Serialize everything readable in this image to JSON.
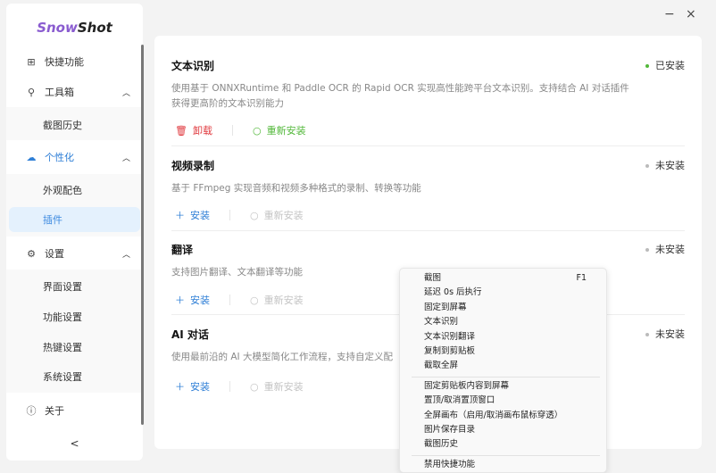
{
  "app": {
    "logo_part1": "Snow",
    "logo_part2": "Shot",
    "minimize": "−",
    "close": "×",
    "collapse": "<"
  },
  "sidebar": {
    "items": [
      {
        "label": "快捷功能",
        "icon": "grid-icon"
      },
      {
        "label": "工具箱",
        "icon": "wrench-icon"
      },
      {
        "label": "截图历史"
      },
      {
        "label": "个性化",
        "icon": "palette-icon"
      },
      {
        "label": "外观配色"
      },
      {
        "label": "插件"
      },
      {
        "label": "设置",
        "icon": "gear-icon"
      },
      {
        "label": "界面设置"
      },
      {
        "label": "功能设置"
      },
      {
        "label": "热键设置"
      },
      {
        "label": "系统设置"
      },
      {
        "label": "关于",
        "icon": "info-icon"
      }
    ]
  },
  "plugins": [
    {
      "title": "文本识别",
      "status": "已安装",
      "status_color": "#52b83a",
      "desc": "使用基于 ONNXRuntime 和 Paddle OCR 的 Rapid OCR 实现高性能跨平台文本识别。支持结合 AI 对话插件获得更高阶的文本识别能力",
      "action1": "卸载",
      "action2": "重新安装"
    },
    {
      "title": "视频录制",
      "status": "未安装",
      "status_color": "#bbbbbb",
      "desc": "基于 FFmpeg 实现音频和视频多种格式的录制、转换等功能",
      "action1": "安装",
      "action2": "重新安装"
    },
    {
      "title": "翻译",
      "status": "未安装",
      "status_color": "#bbbbbb",
      "desc": "支持图片翻译、文本翻译等功能",
      "action1": "安装",
      "action2": "重新安装"
    },
    {
      "title": "AI 对话",
      "status": "未安装",
      "status_color": "#bbbbbb",
      "desc": "使用最前沿的 AI 大模型简化工作流程，支持自定义配",
      "action1": "安装",
      "action2": "重新安装"
    }
  ],
  "context_menu": {
    "items": [
      {
        "label": "截图",
        "shortcut": "F1"
      },
      {
        "label": "延迟 0s 后执行"
      },
      {
        "label": "固定到屏幕"
      },
      {
        "label": "文本识别"
      },
      {
        "label": "文本识别翻译"
      },
      {
        "label": "复制到剪贴板"
      },
      {
        "label": "截取全屏"
      },
      {
        "label": "固定剪贴板内容到屏幕"
      },
      {
        "label": "置顶/取消置顶窗口"
      },
      {
        "label": "全屏画布（启用/取消画布鼠标穿透）"
      },
      {
        "label": "图片保存目录"
      },
      {
        "label": "截图历史"
      },
      {
        "label": "禁用快捷功能"
      }
    ]
  }
}
